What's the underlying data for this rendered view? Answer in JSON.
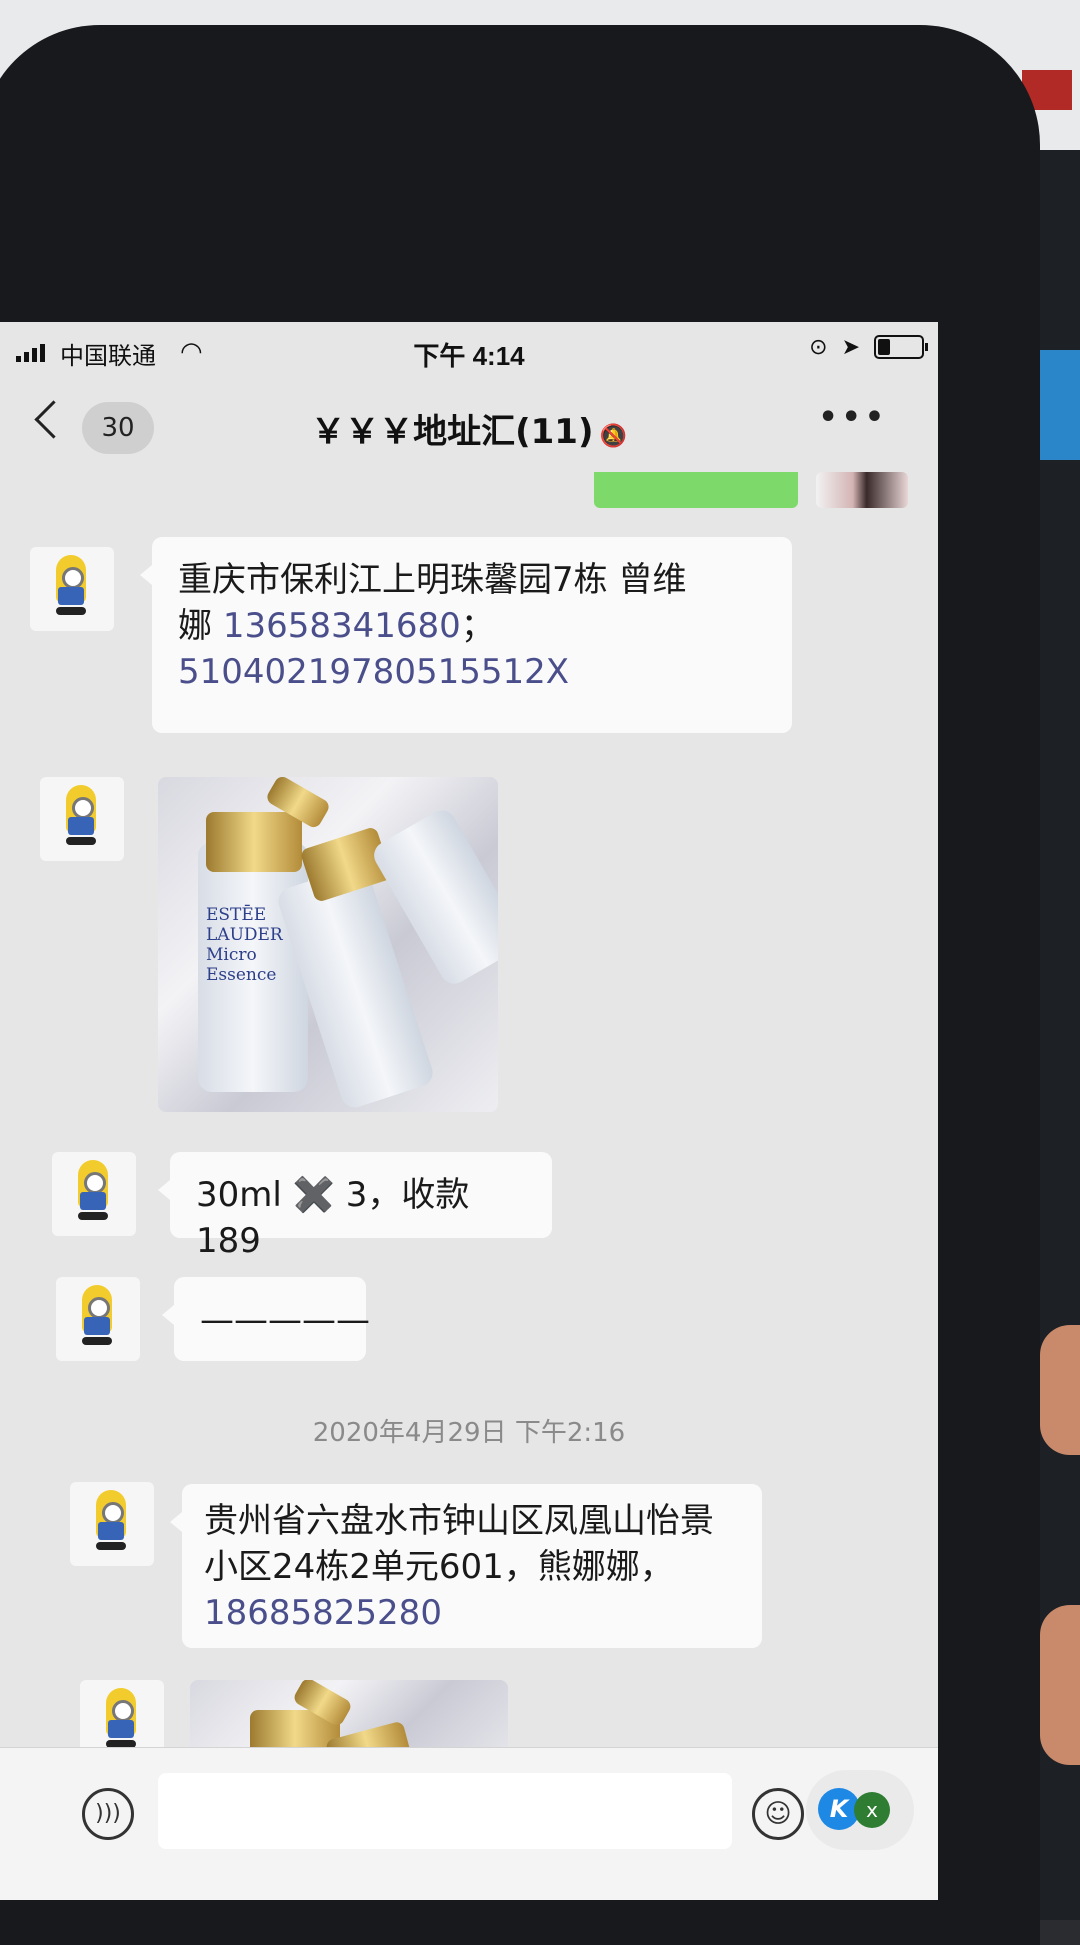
{
  "status_bar": {
    "carrier": "中国联通",
    "time": "下午 4:14"
  },
  "nav": {
    "back_count": "30",
    "title": "￥￥￥地址汇(11)"
  },
  "messages": [
    {
      "type": "text",
      "lines": [
        "重庆市保利江上明珠馨园7栋 曾维",
        "娜 ",
        "13658341680",
        "；",
        "51040219780515512X"
      ]
    },
    {
      "type": "image",
      "brand_line1": "ESTĒE",
      "brand_line2": "LAUDER",
      "product_line1": "Micro",
      "product_line2": "Essence"
    },
    {
      "type": "text",
      "text": "30ml ✖️ 3，收款189"
    },
    {
      "type": "text",
      "text": "—————"
    },
    {
      "type": "timestamp",
      "text": "2020年4月29日 下午2:16"
    },
    {
      "type": "text",
      "lines": [
        "贵州省六盘水市钟山区凤凰山怡景",
        "小区24栋2单元601，熊娜娜，",
        "18685825280"
      ]
    },
    {
      "type": "image"
    }
  ],
  "input_bar": {
    "voice_icon": "voice-icon",
    "emoji_icon": "emoji-icon",
    "float_label_k": "K",
    "float_label_x": "x"
  }
}
